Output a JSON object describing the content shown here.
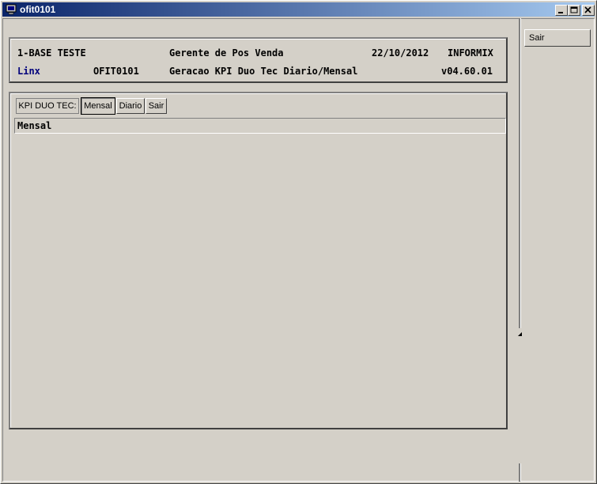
{
  "window": {
    "title": "ofit0101"
  },
  "header": {
    "row1": {
      "left": "1-BASE TESTE",
      "center": "Gerente de Pos Venda",
      "date": "22/10/2012",
      "db": "INFORMIX"
    },
    "row2": {
      "left": "Linx",
      "program": "OFIT0101",
      "center": "Geracao KPI Duo Tec Diario/Mensal",
      "version": "v04.60.01"
    }
  },
  "menu": {
    "prompt": "KPI DUO TEC:",
    "options": [
      "Mensal",
      "Diario",
      "Sair"
    ],
    "selected": "Mensal",
    "status_text": "Mensal"
  },
  "sidebar": {
    "exit_label": "Sair"
  },
  "colors": {
    "linx": "#00007b",
    "titlebar_start": "#0a246a",
    "titlebar_end": "#a6caf0"
  }
}
